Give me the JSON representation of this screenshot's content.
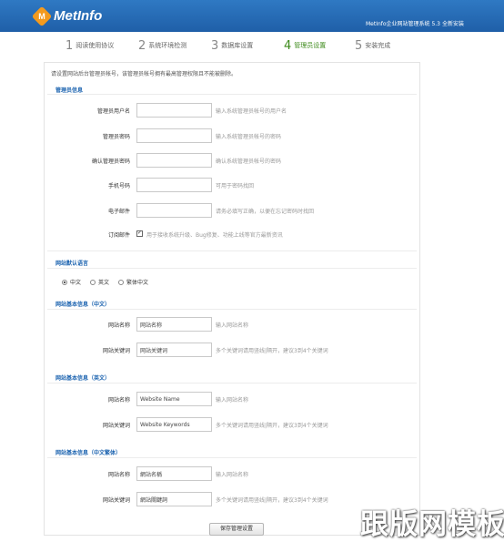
{
  "header": {
    "logo_letter": "M",
    "logo_text": "MetInfo",
    "title": "MetInfo企业网站管理系统 5.3",
    "install_link": "全新安装"
  },
  "steps": [
    {
      "num": "1",
      "label": "阅读使用协议"
    },
    {
      "num": "2",
      "label": "系统环境检测"
    },
    {
      "num": "3",
      "label": "数据库设置"
    },
    {
      "num": "4",
      "label": "管理员设置"
    },
    {
      "num": "5",
      "label": "安装完成"
    }
  ],
  "notice": "请设置网站后台管理员帐号，该管理员帐号拥有最高管理权限且不能被删除。",
  "admin_section": {
    "title": "管理员信息",
    "rows": [
      {
        "label": "管理员用户名",
        "value": "",
        "hint": "输入系统管理员帐号的用户名"
      },
      {
        "label": "管理员密码",
        "value": "",
        "hint": "输入系统管理员帐号的密码"
      },
      {
        "label": "确认管理员密码",
        "value": "",
        "hint": "确认系统管理员帐号的密码"
      },
      {
        "label": "手机号码",
        "value": "",
        "hint": "可用于密码找回"
      },
      {
        "label": "电子邮件",
        "value": "",
        "hint": "请务必填写正确，以便在忘记密码时找回"
      }
    ],
    "subscribe_label": "订阅邮件",
    "subscribe_text": "用于接收系统升级、Bug修复、功能上线等官方最新资讯"
  },
  "language_section": {
    "title": "网站默认语言",
    "options": [
      {
        "label": "中文",
        "selected": true
      },
      {
        "label": "英文",
        "selected": false
      },
      {
        "label": "繁体中文",
        "selected": false
      }
    ]
  },
  "basic_cn": {
    "title": "网站基本信息（中文）",
    "name_label": "网站名称",
    "name_value": "网站名称",
    "name_hint": "输入网站名称",
    "kw_label": "网站关键词",
    "kw_value": "网站关键词",
    "kw_hint": "多个关键词请用竖线|隔开，建议3到4个关键词"
  },
  "basic_en": {
    "title": "网站基本信息（英文）",
    "name_label": "网站名称",
    "name_value": "Website Name",
    "name_hint": "输入网站名称",
    "kw_label": "网站关键词",
    "kw_value": "Website Keywords",
    "kw_hint": "多个关键词请用竖线|隔开，建议3到4个关键词"
  },
  "basic_tc": {
    "title": "网站基本信息（中文繁体）",
    "name_label": "网站名称",
    "name_value": "網站名稱",
    "name_hint": "输入网站名称",
    "kw_label": "网站关键词",
    "kw_value": "網站關鍵詞",
    "kw_hint": "多个关键词请用竖线|隔开，建议3到4个关键词"
  },
  "save_button": "保存管理设置",
  "watermark": "跟版网模板"
}
